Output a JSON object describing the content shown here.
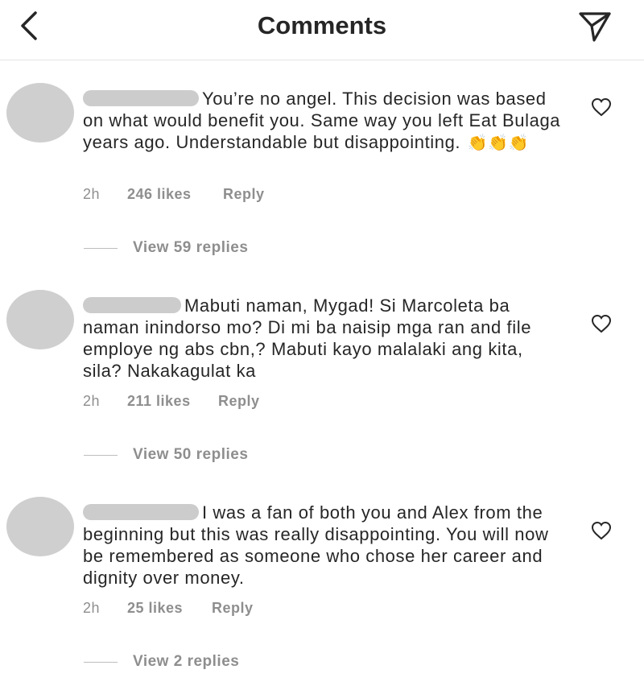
{
  "header": {
    "title": "Comments",
    "back_icon": "chevron-left-icon",
    "send_icon": "paper-plane-icon"
  },
  "comments": [
    {
      "text": "You’re no angel. This decision was based on what would benefit you. Same way you left Eat Bulaga years ago. Understandable but disappointing.",
      "emoji": "👏👏👏",
      "time": "2h",
      "likes": "246 likes",
      "reply": "Reply",
      "view_replies": "View 59 replies"
    },
    {
      "text": "Mabuti naman, Mygad! Si Marcoleta ba naman inindorso mo? Di mi ba naisip mga ran and file employe ng abs cbn,? Mabuti kayo malalaki ang kita, sila? Nakakagulat ka",
      "emoji": "",
      "time": "2h",
      "likes": "211 likes",
      "reply": "Reply",
      "view_replies": "View 50 replies"
    },
    {
      "text": "I was a fan of both you and Alex from the beginning but this was really disappointing. You will now be remembered as someone who chose her career and dignity over money.",
      "emoji": "",
      "time": "2h",
      "likes": "25 likes",
      "reply": "Reply",
      "view_replies": "View 2 replies"
    }
  ],
  "colors": {
    "text": "#262626",
    "muted": "#8e8e8e",
    "avatar": "#cfcfcf",
    "redaction": "#cccccc"
  }
}
